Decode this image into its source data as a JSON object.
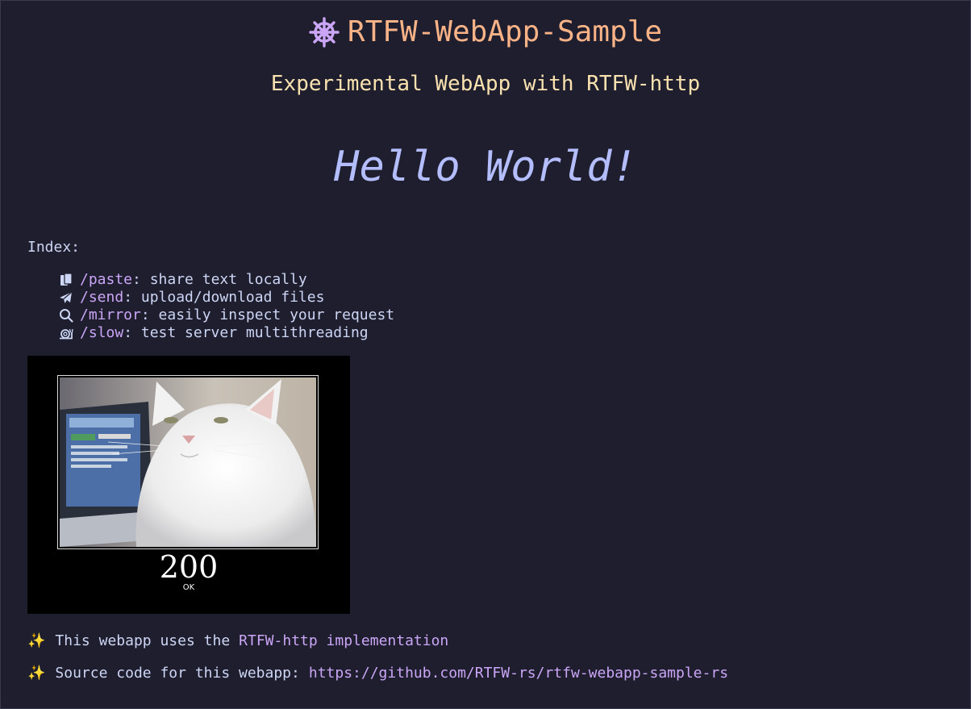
{
  "header": {
    "title": "RTFW-WebApp-Sample",
    "subtitle": "Experimental WebApp with RTFW-http",
    "logo_icon": "helm-wheel-icon"
  },
  "hero": {
    "text": "Hello World!"
  },
  "index": {
    "label": "Index:",
    "items": [
      {
        "icon": "clipboard-icon",
        "path": "/paste",
        "description": ": share text locally"
      },
      {
        "icon": "paper-plane-icon",
        "path": "/send",
        "description": ": upload/download files"
      },
      {
        "icon": "search-icon",
        "path": "/mirror",
        "description": ": easily inspect your request"
      },
      {
        "icon": "snail-icon",
        "path": "/slow",
        "description": ": test server multithreading"
      }
    ]
  },
  "status_image": {
    "code": "200",
    "text": "OK"
  },
  "footer": {
    "line1_prefix": "This webapp uses the ",
    "line1_link": "RTFW-http implementation",
    "line2_prefix": "Source code for this webapp: ",
    "line2_link": "https://github.com/RTFW-rs/rtfw-webapp-sample-rs",
    "spark_icon": "sparkles-icon"
  },
  "colors": {
    "background": "#1e1e2e",
    "title": "#fab387",
    "subtitle": "#f9e2af",
    "hero": "#b4befe",
    "link": "#cba6f7",
    "text": "#cdd6f4"
  }
}
